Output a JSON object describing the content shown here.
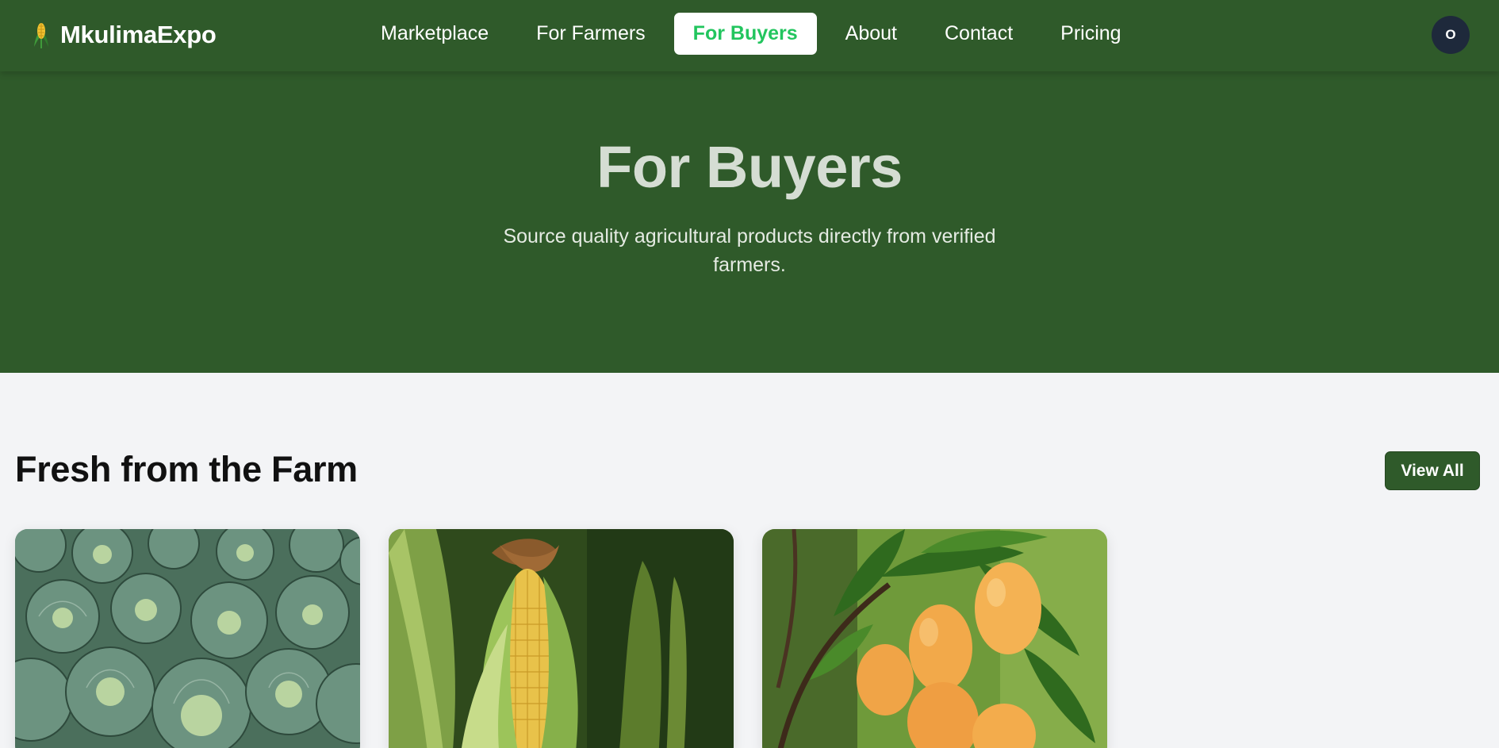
{
  "brand": {
    "name": "MkulimaExpo",
    "icon": "corn-icon"
  },
  "nav": {
    "items": [
      {
        "label": "Marketplace",
        "active": false
      },
      {
        "label": "For Farmers",
        "active": false
      },
      {
        "label": "For Buyers",
        "active": true
      },
      {
        "label": "About",
        "active": false
      },
      {
        "label": "Contact",
        "active": false
      },
      {
        "label": "Pricing",
        "active": false
      }
    ]
  },
  "user": {
    "avatar_initial": "O"
  },
  "hero": {
    "title": "For Buyers",
    "subtitle": "Source quality agricultural products directly from verified farmers."
  },
  "section": {
    "title": "Fresh from the Farm",
    "view_all_label": "View All"
  },
  "products": [
    {
      "image": "cabbage-field-image"
    },
    {
      "image": "maize-cob-image"
    },
    {
      "image": "mango-branch-image"
    }
  ],
  "colors": {
    "primary_green": "#2f5a2a",
    "active_link_text": "#22c55e",
    "page_background": "#f3f4f6",
    "avatar_background": "#1e293b"
  }
}
